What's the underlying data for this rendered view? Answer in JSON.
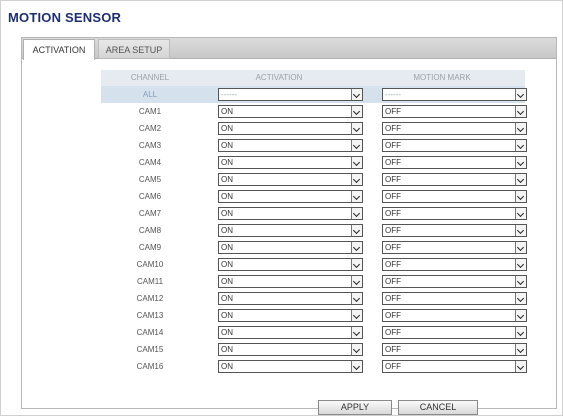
{
  "page": {
    "title": "MOTION SENSOR"
  },
  "tabs": [
    {
      "label": "ACTIVATION",
      "active": true
    },
    {
      "label": "AREA SETUP",
      "active": false
    }
  ],
  "table": {
    "headers": {
      "channel": "CHANNEL",
      "activation": "ACTIVATION",
      "motion_mark": "MOTION MARK"
    },
    "all_row": {
      "channel": "ALL",
      "activation": "------",
      "motion_mark": "------"
    },
    "rows": [
      {
        "channel": "CAM1",
        "activation": "ON",
        "motion_mark": "OFF"
      },
      {
        "channel": "CAM2",
        "activation": "ON",
        "motion_mark": "OFF"
      },
      {
        "channel": "CAM3",
        "activation": "ON",
        "motion_mark": "OFF"
      },
      {
        "channel": "CAM4",
        "activation": "ON",
        "motion_mark": "OFF"
      },
      {
        "channel": "CAM5",
        "activation": "ON",
        "motion_mark": "OFF"
      },
      {
        "channel": "CAM6",
        "activation": "ON",
        "motion_mark": "OFF"
      },
      {
        "channel": "CAM7",
        "activation": "ON",
        "motion_mark": "OFF"
      },
      {
        "channel": "CAM8",
        "activation": "ON",
        "motion_mark": "OFF"
      },
      {
        "channel": "CAM9",
        "activation": "ON",
        "motion_mark": "OFF"
      },
      {
        "channel": "CAM10",
        "activation": "ON",
        "motion_mark": "OFF"
      },
      {
        "channel": "CAM11",
        "activation": "ON",
        "motion_mark": "OFF"
      },
      {
        "channel": "CAM12",
        "activation": "ON",
        "motion_mark": "OFF"
      },
      {
        "channel": "CAM13",
        "activation": "ON",
        "motion_mark": "OFF"
      },
      {
        "channel": "CAM14",
        "activation": "ON",
        "motion_mark": "OFF"
      },
      {
        "channel": "CAM15",
        "activation": "ON",
        "motion_mark": "OFF"
      },
      {
        "channel": "CAM16",
        "activation": "ON",
        "motion_mark": "OFF"
      }
    ]
  },
  "buttons": {
    "apply": "APPLY",
    "cancel": "CANCEL"
  },
  "icons": {
    "dropdown": "chevron-down-icon"
  },
  "colors": {
    "title": "#1f2f6e",
    "header_bg": "#e6ebf1",
    "all_row_bg": "#d6e1ee"
  }
}
